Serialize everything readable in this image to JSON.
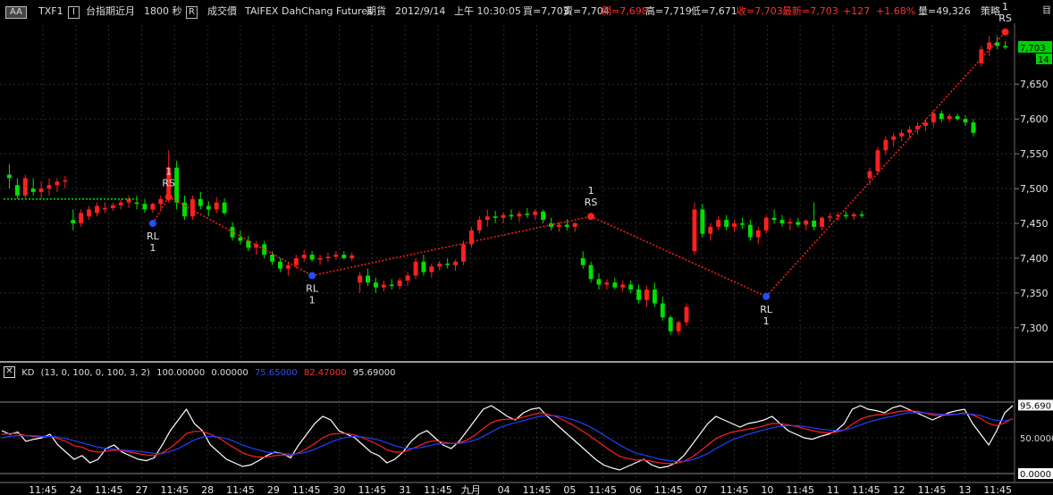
{
  "header": {
    "aa_button": "AA",
    "symbol": "TXF1",
    "interval_button": "I",
    "product": "台指期近月",
    "interval": "1800 秒",
    "field_button": "R",
    "field": "成交價",
    "exchange": "TAIFEX",
    "broker": "DahChang Futures",
    "market": "期貨",
    "date": "2012/9/14",
    "time": "上午 10:30:05",
    "bid": "買=7,703",
    "ask": "賣=7,704",
    "open": "開=7,698",
    "high": "高=7,719",
    "low": "低=7,671",
    "close": "收=7,703",
    "last": "最新=7,703",
    "change": "+127",
    "change_pct": "+1.68%",
    "volume": "量=49,326",
    "strategy": "策略",
    "corner_icon": "目"
  },
  "colors": {
    "up": "#ff2020",
    "down": "#00e000",
    "k": "#ff2020",
    "d": "#2040ff",
    "raw": "#ffffff",
    "grid": "#2a2a2a",
    "zigzag_up": "#ff2020",
    "zigzag_flat": "#00e000"
  },
  "kd_panel": {
    "close_icon": "close-icon",
    "title": "KD",
    "params": "(13, 0, 100, 0, 100, 3, 2)",
    "v1": "100.00000",
    "v2": "0.00000",
    "v3": "75.65000",
    "v4": "82.47000",
    "v5": "95.69000",
    "tag_high": "95.690",
    "tag_mid": "50.0000",
    "tag_low": "0.0000"
  },
  "chart_data": [
    {
      "type": "candlestick",
      "title": "",
      "ylim": [
        7260,
        7735
      ],
      "y_ticks": [
        "7,650",
        "7,600",
        "7,550",
        "7,500",
        "7,450",
        "7,400",
        "7,350",
        "7,300"
      ],
      "last_price_tag": "7,703",
      "last_count_tag": "14",
      "x_tick_labels": [
        "11:45",
        "24",
        "11:45",
        "27",
        "11:45",
        "28",
        "11:45",
        "29",
        "11:45",
        "30",
        "11:45",
        "31",
        "11:45",
        "九月",
        "04",
        "11:45",
        "05",
        "11:45",
        "06",
        "11:45",
        "07",
        "11:45",
        "10",
        "11:45",
        "11",
        "11:45",
        "12",
        "11:45",
        "13",
        "11:45"
      ],
      "ohlc": [
        [
          7520,
          7535,
          7500,
          7515
        ],
        [
          7505,
          7515,
          7485,
          7490
        ],
        [
          7490,
          7520,
          7485,
          7515
        ],
        [
          7500,
          7515,
          7490,
          7495
        ],
        [
          7495,
          7510,
          7485,
          7500
        ],
        [
          7500,
          7515,
          7490,
          7505
        ],
        [
          7505,
          7515,
          7495,
          7510
        ],
        [
          7510,
          7518,
          7500,
          7512
        ],
        [
          7455,
          7470,
          7440,
          7450
        ],
        [
          7450,
          7470,
          7445,
          7465
        ],
        [
          7460,
          7475,
          7455,
          7470
        ],
        [
          7465,
          7480,
          7460,
          7475
        ],
        [
          7470,
          7480,
          7465,
          7472
        ],
        [
          7472,
          7480,
          7468,
          7476
        ],
        [
          7476,
          7485,
          7470,
          7480
        ],
        [
          7480,
          7490,
          7472,
          7485
        ],
        [
          7480,
          7490,
          7470,
          7478
        ],
        [
          7478,
          7485,
          7465,
          7470
        ],
        [
          7470,
          7480,
          7465,
          7478
        ],
        [
          7478,
          7490,
          7470,
          7485
        ],
        [
          7485,
          7555,
          7480,
          7530
        ],
        [
          7530,
          7540,
          7470,
          7480
        ],
        [
          7480,
          7490,
          7455,
          7460
        ],
        [
          7460,
          7490,
          7455,
          7485
        ],
        [
          7485,
          7495,
          7470,
          7475
        ],
        [
          7475,
          7482,
          7460,
          7470
        ],
        [
          7470,
          7488,
          7465,
          7480
        ],
        [
          7480,
          7486,
          7462,
          7465
        ],
        [
          7445,
          7452,
          7425,
          7430
        ],
        [
          7430,
          7440,
          7420,
          7425
        ],
        [
          7425,
          7432,
          7410,
          7415
        ],
        [
          7415,
          7425,
          7405,
          7420
        ],
        [
          7420,
          7425,
          7400,
          7405
        ],
        [
          7405,
          7410,
          7390,
          7395
        ],
        [
          7395,
          7400,
          7380,
          7385
        ],
        [
          7385,
          7395,
          7375,
          7390
        ],
        [
          7390,
          7405,
          7385,
          7400
        ],
        [
          7400,
          7412,
          7395,
          7405
        ],
        [
          7405,
          7410,
          7395,
          7398
        ],
        [
          7398,
          7405,
          7390,
          7400
        ],
        [
          7400,
          7408,
          7395,
          7402
        ],
        [
          7402,
          7410,
          7398,
          7405
        ],
        [
          7405,
          7410,
          7398,
          7400
        ],
        [
          7400,
          7408,
          7396,
          7404
        ],
        [
          7365,
          7380,
          7350,
          7375
        ],
        [
          7375,
          7385,
          7360,
          7365
        ],
        [
          7365,
          7372,
          7350,
          7358
        ],
        [
          7358,
          7368,
          7352,
          7362
        ],
        [
          7362,
          7370,
          7355,
          7360
        ],
        [
          7360,
          7372,
          7355,
          7368
        ],
        [
          7368,
          7380,
          7360,
          7375
        ],
        [
          7375,
          7400,
          7370,
          7395
        ],
        [
          7395,
          7405,
          7375,
          7380
        ],
        [
          7380,
          7392,
          7372,
          7388
        ],
        [
          7388,
          7396,
          7382,
          7392
        ],
        [
          7392,
          7400,
          7385,
          7390
        ],
        [
          7390,
          7398,
          7382,
          7395
        ],
        [
          7395,
          7425,
          7390,
          7420
        ],
        [
          7420,
          7445,
          7415,
          7440
        ],
        [
          7440,
          7460,
          7435,
          7455
        ],
        [
          7455,
          7470,
          7445,
          7460
        ],
        [
          7460,
          7468,
          7450,
          7458
        ],
        [
          7458,
          7466,
          7450,
          7462
        ],
        [
          7462,
          7470,
          7455,
          7460
        ],
        [
          7460,
          7468,
          7452,
          7464
        ],
        [
          7464,
          7472,
          7458,
          7462
        ],
        [
          7462,
          7470,
          7455,
          7467
        ],
        [
          7467,
          7470,
          7450,
          7455
        ],
        [
          7450,
          7458,
          7440,
          7445
        ],
        [
          7445,
          7452,
          7438,
          7448
        ],
        [
          7448,
          7456,
          7440,
          7445
        ],
        [
          7445,
          7452,
          7438,
          7450
        ],
        [
          7400,
          7410,
          7385,
          7390
        ],
        [
          7390,
          7395,
          7365,
          7370
        ],
        [
          7370,
          7378,
          7355,
          7362
        ],
        [
          7362,
          7370,
          7355,
          7365
        ],
        [
          7365,
          7372,
          7355,
          7358
        ],
        [
          7358,
          7368,
          7352,
          7362
        ],
        [
          7362,
          7368,
          7350,
          7355
        ],
        [
          7355,
          7362,
          7335,
          7340
        ],
        [
          7340,
          7360,
          7330,
          7355
        ],
        [
          7355,
          7365,
          7330,
          7335
        ],
        [
          7335,
          7345,
          7310,
          7315
        ],
        [
          7315,
          7318,
          7290,
          7295
        ],
        [
          7295,
          7310,
          7290,
          7308
        ],
        [
          7308,
          7335,
          7302,
          7330
        ],
        [
          7410,
          7480,
          7405,
          7470
        ],
        [
          7470,
          7478,
          7430,
          7435
        ],
        [
          7435,
          7450,
          7425,
          7445
        ],
        [
          7445,
          7460,
          7440,
          7455
        ],
        [
          7455,
          7462,
          7440,
          7445
        ],
        [
          7445,
          7455,
          7438,
          7450
        ],
        [
          7450,
          7458,
          7442,
          7448
        ],
        [
          7448,
          7455,
          7425,
          7430
        ],
        [
          7430,
          7445,
          7420,
          7440
        ],
        [
          7440,
          7462,
          7435,
          7458
        ],
        [
          7458,
          7470,
          7450,
          7455
        ],
        [
          7455,
          7462,
          7445,
          7450
        ],
        [
          7450,
          7458,
          7440,
          7452
        ],
        [
          7452,
          7458,
          7445,
          7448
        ],
        [
          7448,
          7456,
          7440,
          7454
        ],
        [
          7454,
          7480,
          7440,
          7445
        ],
        [
          7445,
          7460,
          7440,
          7458
        ],
        [
          7458,
          7465,
          7452,
          7460
        ],
        [
          7460,
          7466,
          7454,
          7462
        ],
        [
          7462,
          7468,
          7456,
          7460
        ],
        [
          7460,
          7466,
          7455,
          7463
        ],
        [
          7463,
          7468,
          7458,
          7461
        ],
        [
          7515,
          7530,
          7505,
          7525
        ],
        [
          7525,
          7560,
          7520,
          7555
        ],
        [
          7555,
          7575,
          7548,
          7570
        ],
        [
          7570,
          7580,
          7560,
          7575
        ],
        [
          7575,
          7585,
          7568,
          7580
        ],
        [
          7580,
          7590,
          7572,
          7585
        ],
        [
          7585,
          7595,
          7578,
          7590
        ],
        [
          7590,
          7600,
          7583,
          7595
        ],
        [
          7595,
          7612,
          7588,
          7608
        ],
        [
          7608,
          7612,
          7595,
          7600
        ],
        [
          7600,
          7608,
          7595,
          7604
        ],
        [
          7604,
          7608,
          7598,
          7600
        ],
        [
          7600,
          7605,
          7590,
          7595
        ],
        [
          7595,
          7600,
          7575,
          7580
        ],
        [
          7680,
          7705,
          7675,
          7700
        ],
        [
          7700,
          7719,
          7690,
          7710
        ],
        [
          7710,
          7719,
          7700,
          7705
        ],
        [
          7705,
          7712,
          7700,
          7703
        ]
      ],
      "signals": [
        {
          "label": "RL",
          "count": "1",
          "price": 7450
        },
        {
          "label": "RS",
          "count": "1",
          "price": 7488
        },
        {
          "label": "RL",
          "count": "1",
          "price": 7375
        },
        {
          "label": "RS",
          "count": "1",
          "price": 7460
        },
        {
          "label": "RL",
          "count": "1",
          "price": 7345
        },
        {
          "label": "RS",
          "count": "1",
          "price": 7725
        }
      ]
    },
    {
      "type": "line",
      "title": "KD",
      "ylim": [
        0,
        100
      ],
      "y_ticks": [
        "95.690",
        "50.0000",
        "0.0000"
      ],
      "series": [
        {
          "name": "RSV",
          "values": [
            60,
            55,
            58,
            45,
            48,
            50,
            55,
            40,
            30,
            20,
            25,
            15,
            20,
            35,
            40,
            30,
            25,
            20,
            18,
            22,
            40,
            60,
            75,
            90,
            70,
            60,
            40,
            30,
            20,
            15,
            10,
            12,
            18,
            25,
            30,
            28,
            22,
            40,
            55,
            70,
            80,
            75,
            60,
            55,
            50,
            40,
            30,
            25,
            15,
            20,
            30,
            45,
            55,
            60,
            50,
            40,
            35,
            45,
            60,
            75,
            90,
            95,
            88,
            80,
            75,
            85,
            90,
            92,
            80,
            70,
            60,
            50,
            40,
            30,
            20,
            12,
            8,
            5,
            10,
            15,
            20,
            12,
            8,
            10,
            15,
            25,
            40,
            55,
            70,
            80,
            75,
            70,
            65,
            70,
            72,
            75,
            80,
            70,
            60,
            55,
            50,
            48,
            52,
            55,
            60,
            70,
            90,
            95,
            90,
            88,
            85,
            92,
            95,
            90,
            85,
            80,
            75,
            80,
            85,
            88,
            90,
            70,
            55,
            40,
            60,
            85,
            95
          ]
        },
        {
          "name": "K",
          "values": [
            55,
            56,
            56,
            53,
            52,
            51,
            52,
            49,
            45,
            39,
            37,
            32,
            30,
            31,
            33,
            32,
            30,
            28,
            26,
            25,
            29,
            36,
            45,
            56,
            59,
            59,
            55,
            50,
            43,
            36,
            29,
            25,
            23,
            23,
            25,
            26,
            25,
            29,
            35,
            42,
            50,
            55,
            56,
            56,
            54,
            50,
            45,
            40,
            33,
            30,
            30,
            34,
            39,
            44,
            46,
            44,
            42,
            43,
            47,
            54,
            63,
            71,
            75,
            76,
            76,
            79,
            82,
            85,
            83,
            80,
            75,
            69,
            62,
            55,
            47,
            39,
            31,
            24,
            21,
            19,
            19,
            17,
            15,
            14,
            14,
            17,
            23,
            31,
            40,
            49,
            54,
            58,
            60,
            62,
            64,
            67,
            70,
            70,
            68,
            66,
            63,
            60,
            58,
            57,
            58,
            61,
            69,
            76,
            80,
            82,
            83,
            85,
            87,
            88,
            87,
            85,
            82,
            81,
            82,
            83,
            85,
            82,
            77,
            70,
            67,
            71,
            77
          ]
        },
        {
          "name": "D",
          "values": [
            50,
            52,
            53,
            53,
            53,
            52,
            52,
            51,
            49,
            46,
            43,
            40,
            37,
            35,
            34,
            33,
            32,
            31,
            30,
            28,
            28,
            31,
            35,
            41,
            47,
            51,
            52,
            51,
            49,
            45,
            40,
            36,
            33,
            30,
            29,
            28,
            27,
            28,
            30,
            34,
            39,
            44,
            48,
            51,
            52,
            51,
            49,
            47,
            43,
            39,
            36,
            35,
            36,
            38,
            41,
            42,
            42,
            42,
            44,
            47,
            52,
            58,
            64,
            68,
            71,
            74,
            77,
            80,
            81,
            81,
            79,
            76,
            72,
            67,
            61,
            54,
            47,
            40,
            34,
            29,
            26,
            23,
            20,
            18,
            17,
            17,
            19,
            23,
            28,
            35,
            41,
            47,
            51,
            55,
            58,
            61,
            64,
            66,
            67,
            67,
            66,
            64,
            62,
            61,
            60,
            61,
            64,
            68,
            72,
            75,
            78,
            80,
            83,
            85,
            85,
            85,
            84,
            83,
            83,
            83,
            84,
            83,
            81,
            77,
            74,
            74,
            76
          ]
        }
      ]
    }
  ]
}
